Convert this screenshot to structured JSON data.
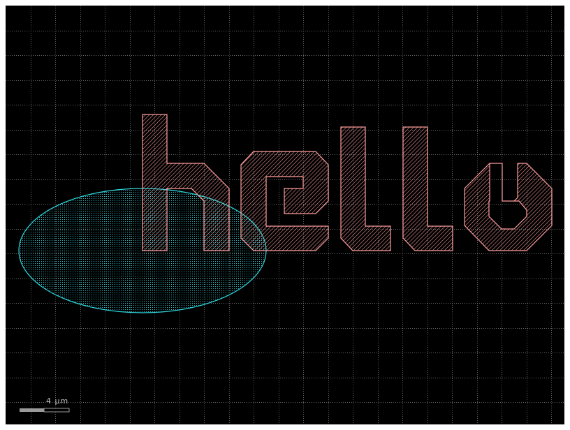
{
  "canvas": {
    "background_color": "#000000",
    "grid_color": "#8a8a8a"
  },
  "layers": {
    "text_layer": {
      "stroke": "#ff9d9d",
      "fill": "#ff9d9d",
      "hatch": "diagonal"
    },
    "ellipse_layer": {
      "stroke": "#2fd8e0",
      "fill": "#2fd8e0",
      "hatch": "dots"
    }
  },
  "shapes": {
    "text_polygons": [
      "h",
      "e",
      "l",
      "l",
      "o"
    ],
    "ellipse": "ellipse"
  },
  "scale_bar": {
    "label": "4 µm"
  }
}
